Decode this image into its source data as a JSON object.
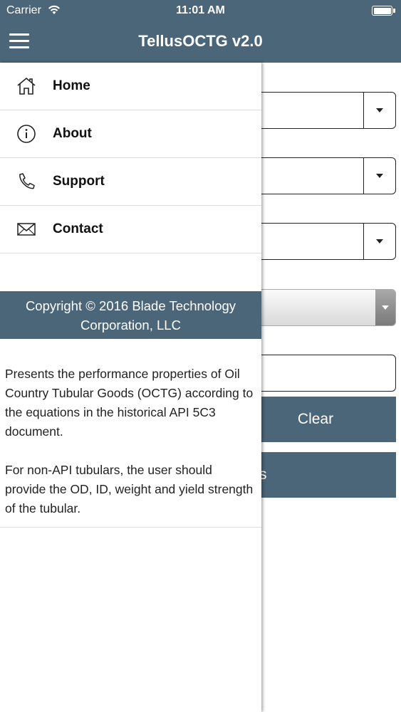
{
  "status_bar": {
    "carrier": "Carrier",
    "time": "11:01 AM",
    "wifi_icon": "wifi-icon",
    "battery_icon": "battery-icon"
  },
  "nav": {
    "title": "TellusOCTG v2.0",
    "menu_icon": "hamburger-menu-icon"
  },
  "drawer": {
    "items": [
      {
        "label": "Home",
        "icon": "home-icon"
      },
      {
        "label": "About",
        "icon": "info-icon"
      },
      {
        "label": "Support",
        "icon": "phone-icon"
      },
      {
        "label": "Contact",
        "icon": "envelope-icon"
      }
    ],
    "copyright": "Copyright © 2016 Blade Technology Corporation, LLC",
    "description": [
      "Presents the performance properties of Oil Country Tubular Goods (OCTG) according to the equations in the historical API 5C3 document.",
      "For non-API tubulars, the user should provide the OD, ID, weight and yield strength of the tubular."
    ]
  },
  "form": {
    "clear_label": "Clear",
    "second_button_label": "s"
  },
  "colors": {
    "header": "#4b6678",
    "button": "#4b6678",
    "text": "#222222"
  }
}
